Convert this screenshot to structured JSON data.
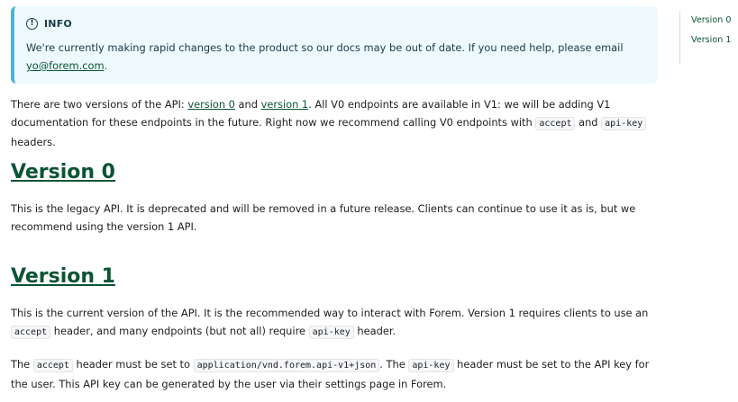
{
  "admonition": {
    "icon": "info-icon",
    "title": "INFO",
    "body_text": "We're currently making rapid changes to the product so our docs may be out of date. If you need help, please email ",
    "email_link": "yo@forem.com",
    "body_end": "."
  },
  "intro": {
    "t1": "There are two versions of the API: ",
    "link_v0": "version 0",
    "t2": " and ",
    "link_v1": "version 1",
    "t3": ". All V0 endpoints are available in V1: we will be adding V1 documentation for these endpoints in the future. Right now we recommend calling V0 endpoints with ",
    "code_accept": "accept",
    "t4": " and ",
    "code_apikey": "api-key",
    "t5": " headers."
  },
  "v0": {
    "heading": "Version 0",
    "text": "This is the legacy API. It is deprecated and will be removed in a future release. Clients can continue to use it as is, but we recommend using the version 1 API."
  },
  "v1": {
    "heading": "Version 1",
    "p1_t1": "This is the current version of the API. It is the recommended way to interact with Forem. Version 1 requires clients to use an ",
    "p1_code_accept": "accept",
    "p1_t2": " header, and many endpoints (but not all) require ",
    "p1_code_apikey": "api-key",
    "p1_t3": " header.",
    "p2_t1": "The ",
    "p2_code_accept": "accept",
    "p2_t2": " header must be set to ",
    "p2_code_mime": "application/vnd.forem.api-v1+json",
    "p2_t3": ". The ",
    "p2_code_apikey": "api-key",
    "p2_t4": " header must be set to the API key for the user. This API key can be generated by the user via their settings page in Forem."
  },
  "toc": {
    "items": [
      "Version 0",
      "Version 1"
    ]
  },
  "colors": {
    "link": "#0a5532",
    "admonition_bg": "#eef9fd",
    "admonition_border": "#4cb3d4"
  }
}
